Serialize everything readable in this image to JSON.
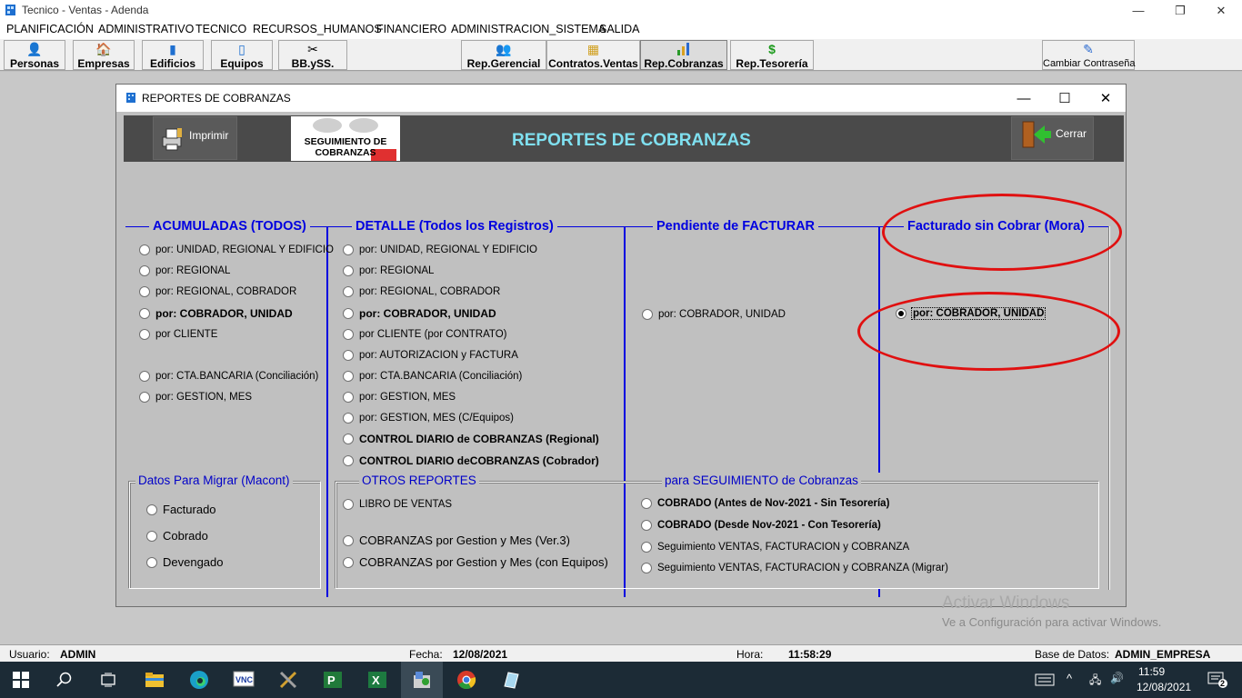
{
  "app": {
    "title": "Tecnico - Ventas - Adenda"
  },
  "menu": [
    "PLANIFICACIÓN",
    "ADMINISTRATIVO",
    "TECNICO",
    "RECURSOS_HUMANOS",
    "FINANCIERO",
    "ADMINISTRACION_SISTEMA",
    "SALIDA"
  ],
  "toolbar": [
    {
      "label": "Personas",
      "icon": "people-icon"
    },
    {
      "label": "Empresas",
      "icon": "house-icon"
    },
    {
      "label": "Edificios",
      "icon": "building-icon"
    },
    {
      "label": "Equipos",
      "icon": "phone-icon"
    },
    {
      "label": "BB.ySS.",
      "icon": "tools-icon"
    },
    {
      "label": "Rep.Gerencial",
      "icon": "group-icon"
    },
    {
      "label": "Contratos.Ventas",
      "icon": "contract-icon"
    },
    {
      "label": "Rep.Cobranzas",
      "icon": "bar-chart-icon",
      "active": true
    },
    {
      "label": "Rep.Tesorería",
      "icon": "dollar-icon"
    },
    {
      "label": "Cambiar Contraseña",
      "icon": "key-icon"
    }
  ],
  "dialog": {
    "title": "REPORTES DE COBRANZAS",
    "banner": {
      "print_label": "Imprimir",
      "seguimiento_label": "SEGUIMIENTO DE COBRANZAS",
      "title": "REPORTES DE COBRANZAS",
      "close_label": "Cerrar"
    },
    "sections": {
      "acumuladas": {
        "title": "ACUMULADAS (TODOS)",
        "options": [
          "por: UNIDAD, REGIONAL Y EDIFICIO",
          "por: REGIONAL",
          "por: REGIONAL, COBRADOR",
          "por: COBRADOR, UNIDAD",
          "por CLIENTE",
          "por: CTA.BANCARIA (Conciliación)",
          "por: GESTION, MES"
        ]
      },
      "detalle": {
        "title": "DETALLE (Todos los Registros)",
        "options": [
          "por: UNIDAD, REGIONAL Y EDIFICIO",
          "por: REGIONAL",
          "por: REGIONAL, COBRADOR",
          "por: COBRADOR, UNIDAD",
          "por CLIENTE (por CONTRATO)",
          "por: AUTORIZACION y FACTURA",
          "por: CTA.BANCARIA (Conciliación)",
          "por: GESTION, MES",
          "por: GESTION, MES (C/Equipos)",
          "CONTROL DIARIO de COBRANZAS (Regional)",
          "CONTROL DIARIO deCOBRANZAS (Cobrador)"
        ]
      },
      "pendiente": {
        "title": "Pendiente de FACTURAR",
        "options": [
          "por: COBRADOR, UNIDAD"
        ]
      },
      "facturado": {
        "title": "Facturado sin Cobrar (Mora)",
        "options": [
          "por: COBRADOR, UNIDAD"
        ],
        "selected": 0
      },
      "migrar": {
        "title": "Datos Para Migrar (Macont)",
        "options": [
          "Facturado",
          "Cobrado",
          "Devengado"
        ]
      },
      "otros": {
        "title": "OTROS REPORTES",
        "options": [
          "LIBRO DE VENTAS",
          "COBRANZAS por Gestion y Mes (Ver.3)",
          "COBRANZAS por Gestion y Mes (con Equipos)"
        ]
      },
      "seguimiento": {
        "title": "para SEGUIMIENTO de Cobranzas",
        "options": [
          "COBRADO (Antes de Nov-2021 - Sin Tesorería)",
          "COBRADO (Desde Nov-2021 - Con Tesorería)",
          "Seguimiento VENTAS, FACTURACION y COBRANZA",
          "Seguimiento VENTAS, FACTURACION y COBRANZA (Migrar)"
        ]
      }
    }
  },
  "watermark": {
    "line1": "Activar Windows",
    "line2": "Ve a Configuración para activar Windows."
  },
  "status": {
    "user_label": "Usuario:",
    "user": "ADMIN",
    "date_label": "Fecha:",
    "date": "12/08/2021",
    "time_label": "Hora:",
    "time": "11:58:29",
    "db_label": "Base de Datos:",
    "db": "ADMIN_EMPRESA"
  },
  "taskbar": {
    "clock_time": "11:59",
    "clock_date": "12/08/2021",
    "notifications": "2"
  },
  "colors": {
    "accent_blue": "#0000e0",
    "banner_title": "#7fe0f0",
    "highlight_red": "#e01010"
  }
}
